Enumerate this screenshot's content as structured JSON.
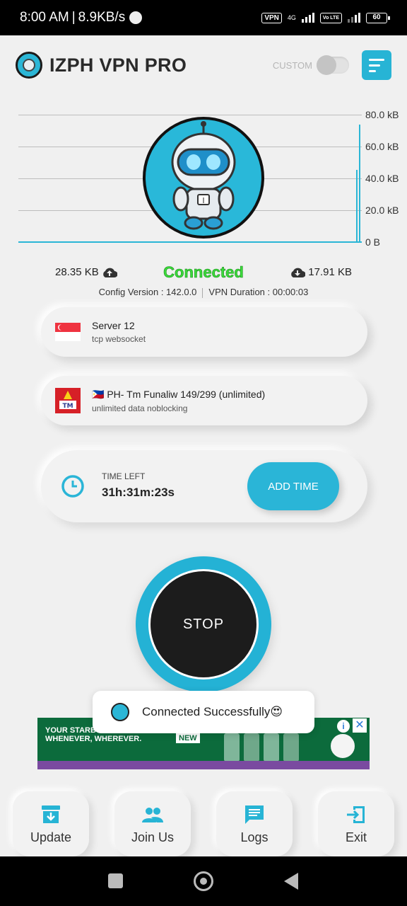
{
  "status_bar": {
    "time": "8:00 AM",
    "separator": "|",
    "speed": "8.9KB/s",
    "vpn_badge": "VPN",
    "network": "4G",
    "volte": "Vo LTE",
    "battery": "60"
  },
  "header": {
    "title": "IZPH VPN PRO",
    "custom_label": "CUSTOM",
    "accent_color": "#27b4d5"
  },
  "graph": {
    "y_ticks": [
      "80.0 kB",
      "60.0 kB",
      "40.0 kB",
      "20.0 kB",
      "0 B"
    ]
  },
  "stats": {
    "upload": "28.35 KB",
    "download": "17.91 KB",
    "status": "Connected",
    "status_color": "#3bd93b",
    "config_version": "Config Version : 142.0.0",
    "vpn_duration": "VPN Duration : 00:00:03"
  },
  "server": {
    "name": "Server 12",
    "protocol": "tcp websocket",
    "flag": "singapore-flag-icon"
  },
  "payload": {
    "name": "🇵🇭 PH- Tm Funaliw 149/299 (unlimited)",
    "description": "unlimited data noblocking",
    "icon": "tm-logo-icon"
  },
  "time_left": {
    "label": "TIME LEFT",
    "value": "31h:31m:23s",
    "button": "ADD TIME"
  },
  "main_button": {
    "label": "STOP"
  },
  "toast": {
    "text": "Connected Successfully😍"
  },
  "ad": {
    "text": "YOUR STARBUCKS COFFEE WHENEVER, WHEREVER.",
    "badge": "NEW",
    "info": "i",
    "close": "✕"
  },
  "bottom_nav": {
    "items": [
      {
        "label": "Update",
        "icon": "download-box-icon"
      },
      {
        "label": "Join Us",
        "icon": "group-icon"
      },
      {
        "label": "Logs",
        "icon": "chat-icon"
      },
      {
        "label": "Exit",
        "icon": "exit-icon"
      }
    ]
  }
}
